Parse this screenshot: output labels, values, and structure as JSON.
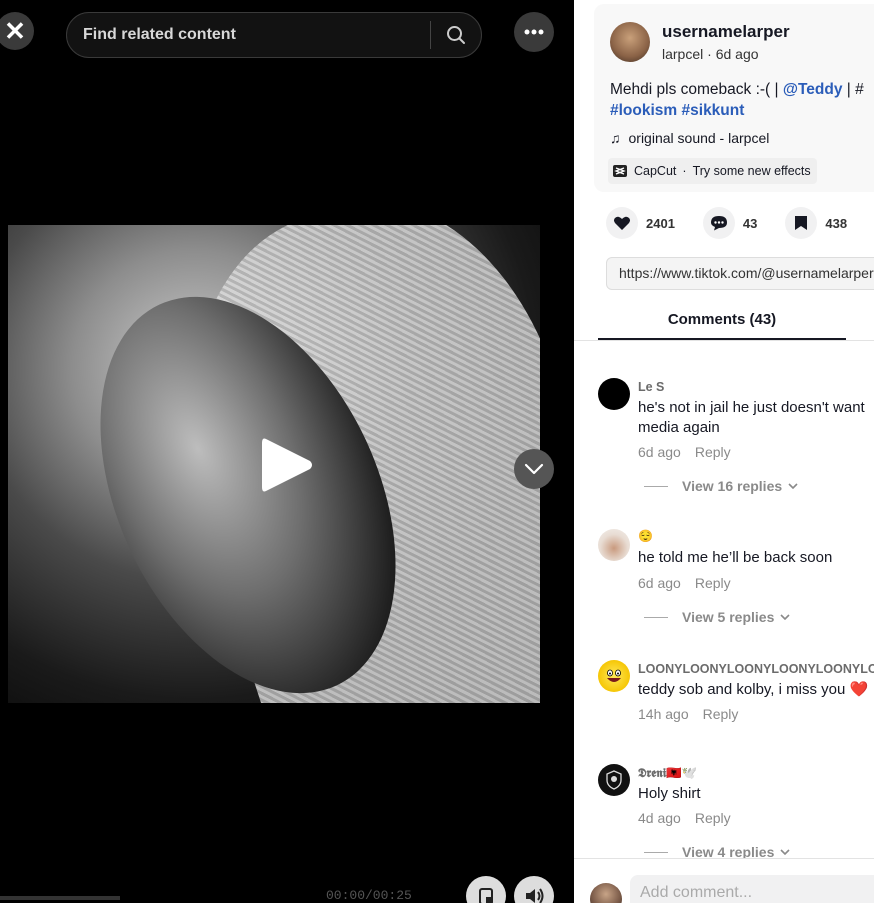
{
  "player": {
    "search_placeholder": "Find related content",
    "time": "00:00/00:25"
  },
  "post": {
    "username": "usernamelarper",
    "author": "larpcel",
    "date": "6d ago",
    "caption_text": "Mehdi pls comeback :-( | ",
    "mention": "@Teddy",
    "caption_sep": " | #",
    "tags": [
      "#lookism",
      "#sikkunt"
    ],
    "music": "original sound - larpcel",
    "capcut_name": "CapCut",
    "capcut_action": "Try some new effects"
  },
  "stats": {
    "likes": "2401",
    "comments": "43",
    "saves": "438"
  },
  "link": "https://www.tiktok.com/@usernamelarper",
  "comments_tab": "Comments (43)",
  "reply_label": "Reply",
  "comments": [
    {
      "user": "Le S",
      "text": "he's not in jail he just doesn't want media again",
      "date": "6d ago",
      "replies": "View 16 replies"
    },
    {
      "user": "😌",
      "text": "he told me he’ll be back soon",
      "date": "6d ago",
      "replies": "View 5 replies"
    },
    {
      "user": "LOONYLOONYLOONYLOONYLOONYLO",
      "text": "teddy sob and kolby, i miss you ❤️",
      "date": "14h ago",
      "replies": ""
    },
    {
      "user": "𝕯𝖗𝖊𝖓𝖎🇦🇱🕊️",
      "text": "Holy shirt",
      "date": "4d ago",
      "replies": "View 4 replies"
    }
  ],
  "add_comment_placeholder": "Add comment..."
}
